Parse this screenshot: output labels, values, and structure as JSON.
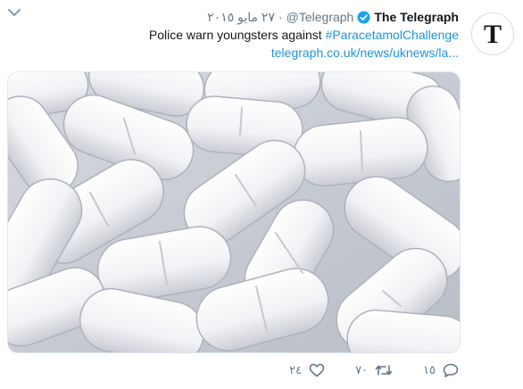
{
  "tweet": {
    "name": "The Telegraph",
    "handle": "@Telegraph",
    "separator": "·",
    "date": "٢٧ مايو ٢٠١٥",
    "text_before": "Police warn youngsters against ",
    "hashtag": "#ParacetamolChallenge",
    "link": "telegraph.co.uk/news/uknews/la...",
    "avatar_letter": "T"
  },
  "media": {
    "icon": "paracetamol-pills-photo"
  },
  "actions": {
    "reply_count": "١٥",
    "retweet_count": "٧٠",
    "like_count": "٢٤"
  },
  "colors": {
    "link": "#1b95e0",
    "muted": "#657786",
    "verified": "#1da1f2"
  }
}
